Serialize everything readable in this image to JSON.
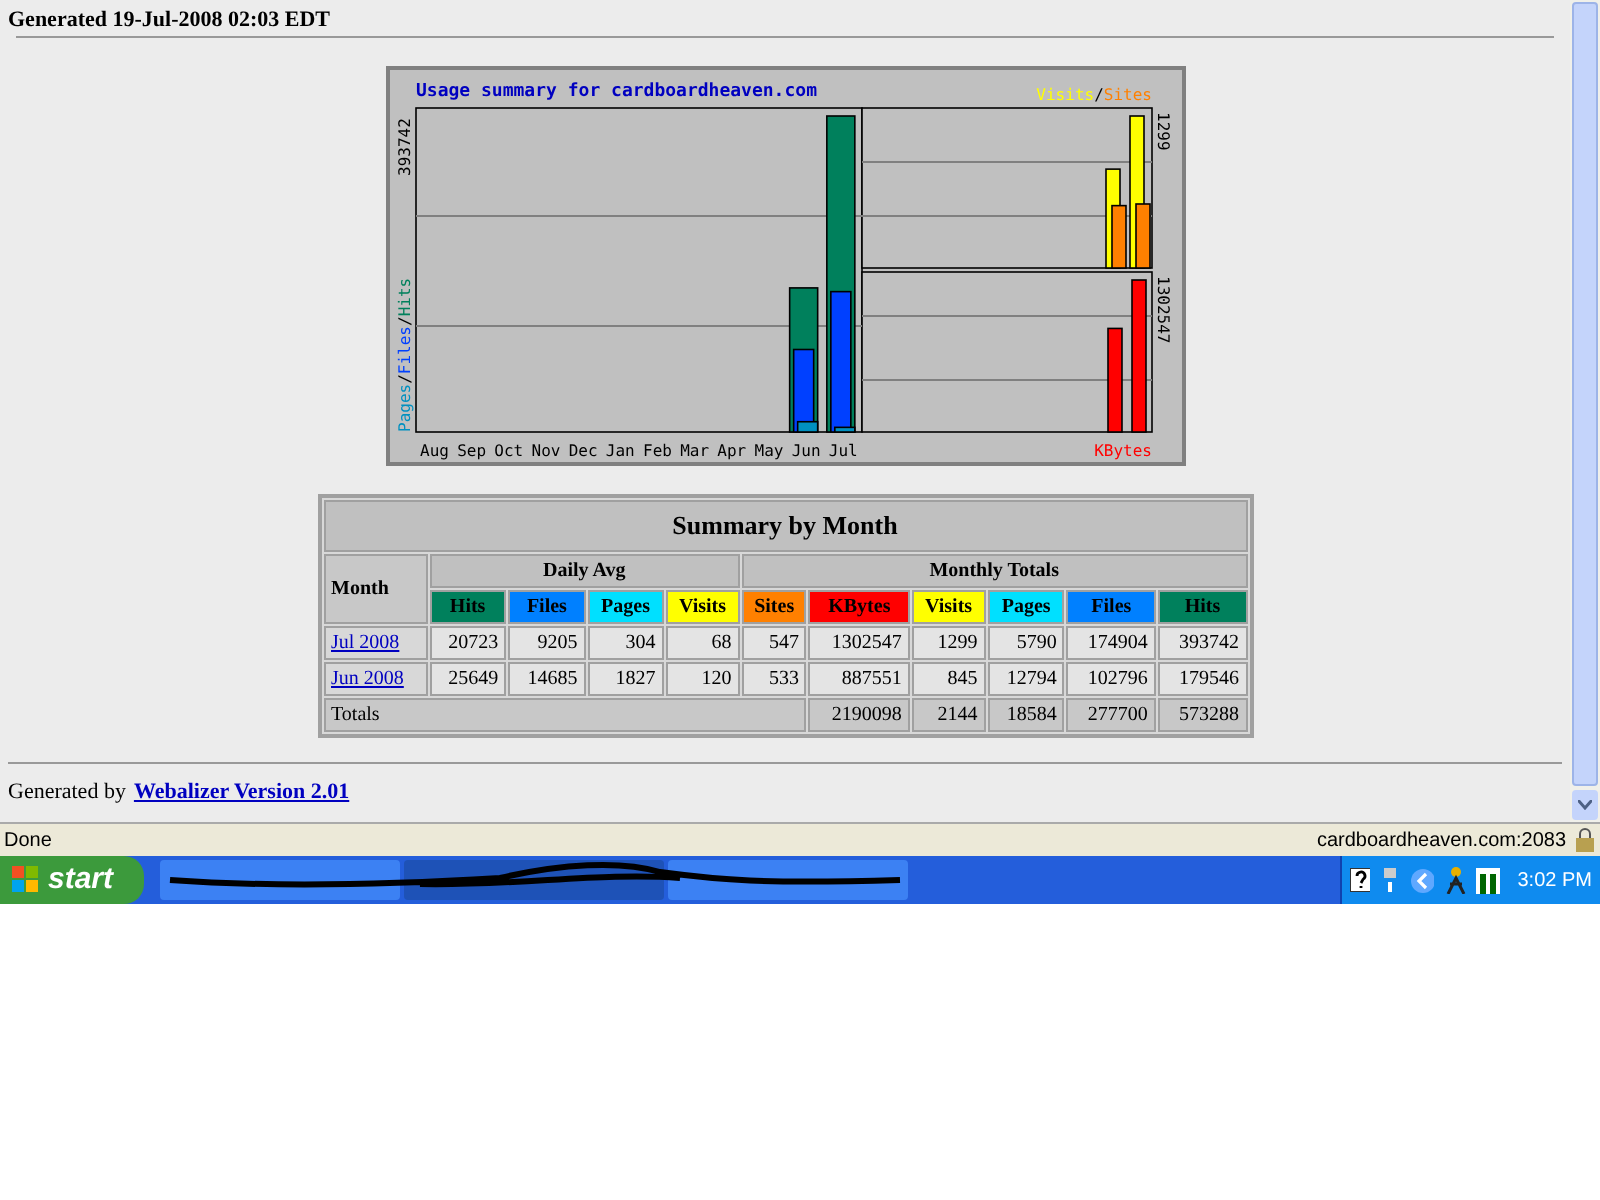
{
  "header": {
    "generated": "Generated 19-Jul-2008 02:03 EDT"
  },
  "usage_graph": {
    "title": "Usage summary for cardboardheaven.com",
    "months": [
      "Aug",
      "Sep",
      "Oct",
      "Nov",
      "Dec",
      "Jan",
      "Feb",
      "Mar",
      "Apr",
      "May",
      "Jun",
      "Jul"
    ],
    "left_legend": [
      {
        "label": "Pages",
        "color": "#0090c0"
      },
      {
        "label": "Files",
        "color": "#0040ff"
      },
      {
        "label": "Hits",
        "color": "#00805c"
      }
    ],
    "right_legend": [
      {
        "label": "Visits",
        "color": "#ffff00"
      },
      {
        "label": "Sites",
        "color": "#ff8000"
      }
    ],
    "separator": "/",
    "hits_max": "393742",
    "visits_max": "1299",
    "kbytes_max": "1302547",
    "kbytes_label": {
      "label": "KBytes",
      "color": "#ff0000"
    }
  },
  "summary": {
    "title": "Summary by Month",
    "month_header": "Month",
    "groups": [
      "Daily Avg",
      "Monthly Totals"
    ],
    "columns": [
      {
        "label": "Hits",
        "color": "#00805c"
      },
      {
        "label": "Files",
        "color": "#0080ff"
      },
      {
        "label": "Pages",
        "color": "#00e0ff"
      },
      {
        "label": "Visits",
        "color": "#ffff00"
      },
      {
        "label": "Sites",
        "color": "#ff8000"
      },
      {
        "label": "KBytes",
        "color": "#ff0000"
      },
      {
        "label": "Visits",
        "color": "#ffff00"
      },
      {
        "label": "Pages",
        "color": "#00e0ff"
      },
      {
        "label": "Files",
        "color": "#0080ff"
      },
      {
        "label": "Hits",
        "color": "#00805c"
      }
    ],
    "rows": [
      {
        "month": "Jul 2008",
        "values": [
          "20723",
          "9205",
          "304",
          "68",
          "547",
          "1302547",
          "1299",
          "5790",
          "174904",
          "393742"
        ]
      },
      {
        "month": "Jun 2008",
        "values": [
          "25649",
          "14685",
          "1827",
          "120",
          "533",
          "887551",
          "845",
          "12794",
          "102796",
          "179546"
        ]
      }
    ],
    "totals": {
      "label": "Totals",
      "values": [
        "2190098",
        "2144",
        "18584",
        "277700",
        "573288"
      ]
    }
  },
  "footer": {
    "prefix": "Generated by",
    "link": "Webalizer Version 2.01"
  },
  "status_bar": {
    "status": "Done",
    "host": "cardboardheaven.com:2083"
  },
  "taskbar": {
    "start": "start",
    "clock": "3:02 PM"
  }
}
